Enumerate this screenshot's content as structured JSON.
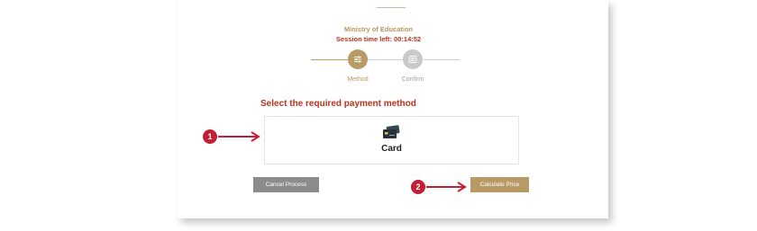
{
  "header": {
    "organization": "Ministry of Education",
    "session_timer": "Session time left: 00:14:52"
  },
  "stepper": {
    "steps": [
      {
        "label": "Method",
        "state": "active",
        "icon": "sliders-icon"
      },
      {
        "label": "Confirm",
        "state": "inactive",
        "icon": "list-icon"
      }
    ]
  },
  "payment": {
    "title": "Select the required payment method",
    "methods": [
      {
        "label": "Card",
        "icon": "credit-card-icon"
      }
    ]
  },
  "actions": {
    "cancel_label": "Cancel Process",
    "calculate_label": "Calculate Price"
  },
  "annotations": [
    {
      "number": "1",
      "target": "payment-method-card"
    },
    {
      "number": "2",
      "target": "calculate-price-button"
    }
  ],
  "colors": {
    "gold": "#b89a66",
    "red": "#b5341f",
    "annotation_red": "#c41e35",
    "inactive_gray": "#c9c9c9",
    "cancel_gray": "#8c8c8c"
  }
}
